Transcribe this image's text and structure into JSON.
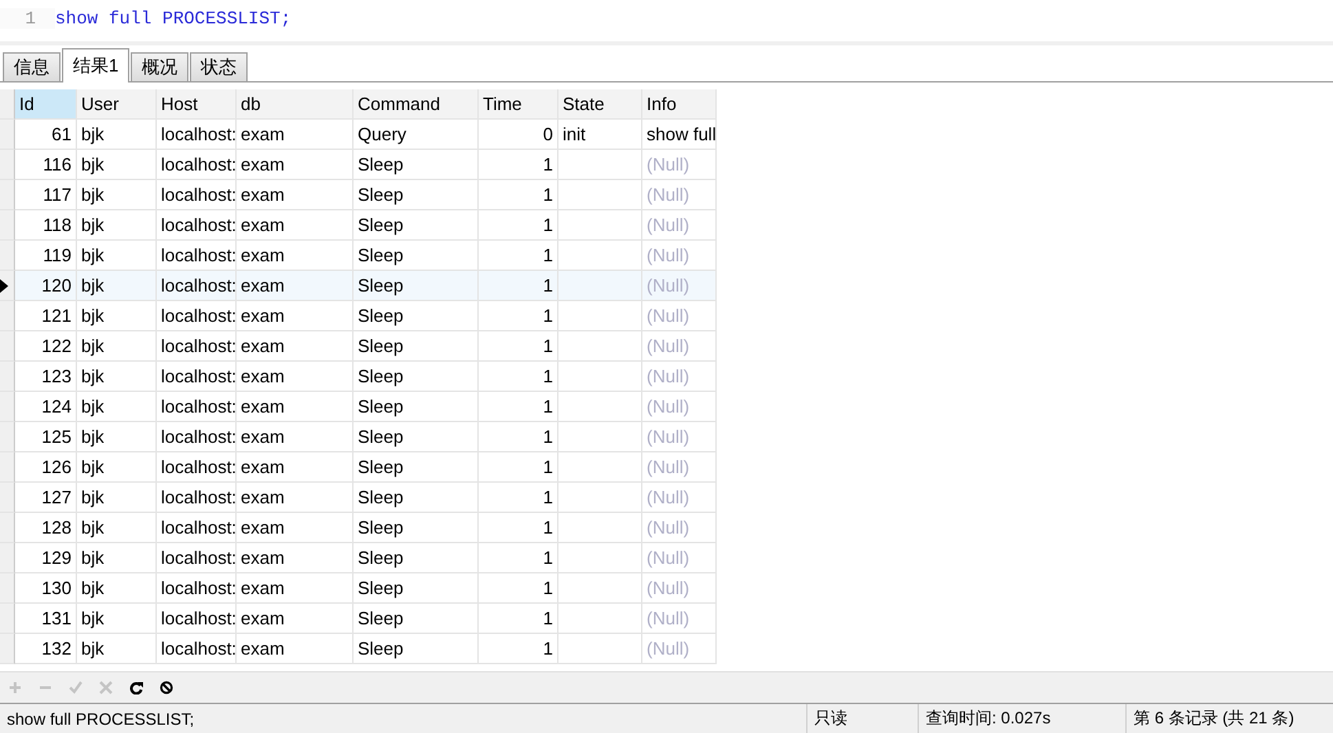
{
  "editor": {
    "lines": [
      {
        "number": "1",
        "code": "show full PROCESSLIST;"
      }
    ]
  },
  "tabs": [
    {
      "label": "信息",
      "selected": false
    },
    {
      "label": "结果1",
      "selected": true
    },
    {
      "label": "概况",
      "selected": false
    },
    {
      "label": "状态",
      "selected": false
    }
  ],
  "table": {
    "columns": [
      {
        "label": "Id",
        "selected": true
      },
      {
        "label": "User",
        "selected": false
      },
      {
        "label": "Host",
        "selected": false
      },
      {
        "label": "db",
        "selected": false
      },
      {
        "label": "Command",
        "selected": false
      },
      {
        "label": "Time",
        "selected": false
      },
      {
        "label": "State",
        "selected": false
      },
      {
        "label": "Info",
        "selected": false
      }
    ],
    "rows": [
      {
        "id": "61",
        "user": "bjk",
        "host": "localhost:",
        "db": "exam",
        "command": "Query",
        "time": "0",
        "state": "init",
        "info": "show full",
        "info_null": false,
        "selected": false
      },
      {
        "id": "116",
        "user": "bjk",
        "host": "localhost:",
        "db": "exam",
        "command": "Sleep",
        "time": "1",
        "info": "(Null)",
        "info_null": true,
        "selected": false
      },
      {
        "id": "117",
        "user": "bjk",
        "host": "localhost:",
        "db": "exam",
        "command": "Sleep",
        "time": "1",
        "info": "(Null)",
        "info_null": true,
        "selected": false
      },
      {
        "id": "118",
        "user": "bjk",
        "host": "localhost:",
        "db": "exam",
        "command": "Sleep",
        "time": "1",
        "info": "(Null)",
        "info_null": true,
        "selected": false
      },
      {
        "id": "119",
        "user": "bjk",
        "host": "localhost:",
        "db": "exam",
        "command": "Sleep",
        "time": "1",
        "info": "(Null)",
        "info_null": true,
        "selected": false
      },
      {
        "id": "120",
        "user": "bjk",
        "host": "localhost:",
        "db": "exam",
        "command": "Sleep",
        "time": "1",
        "info": "(Null)",
        "info_null": true,
        "selected": true
      },
      {
        "id": "121",
        "user": "bjk",
        "host": "localhost:",
        "db": "exam",
        "command": "Sleep",
        "time": "1",
        "info": "(Null)",
        "info_null": true,
        "selected": false
      },
      {
        "id": "122",
        "user": "bjk",
        "host": "localhost:",
        "db": "exam",
        "command": "Sleep",
        "time": "1",
        "info": "(Null)",
        "info_null": true,
        "selected": false
      },
      {
        "id": "123",
        "user": "bjk",
        "host": "localhost:",
        "db": "exam",
        "command": "Sleep",
        "time": "1",
        "info": "(Null)",
        "info_null": true,
        "selected": false
      },
      {
        "id": "124",
        "user": "bjk",
        "host": "localhost:",
        "db": "exam",
        "command": "Sleep",
        "time": "1",
        "info": "(Null)",
        "info_null": true,
        "selected": false
      },
      {
        "id": "125",
        "user": "bjk",
        "host": "localhost:",
        "db": "exam",
        "command": "Sleep",
        "time": "1",
        "info": "(Null)",
        "info_null": true,
        "selected": false
      },
      {
        "id": "126",
        "user": "bjk",
        "host": "localhost:",
        "db": "exam",
        "command": "Sleep",
        "time": "1",
        "info": "(Null)",
        "info_null": true,
        "selected": false
      },
      {
        "id": "127",
        "user": "bjk",
        "host": "localhost:",
        "db": "exam",
        "command": "Sleep",
        "time": "1",
        "info": "(Null)",
        "info_null": true,
        "selected": false
      },
      {
        "id": "128",
        "user": "bjk",
        "host": "localhost:",
        "db": "exam",
        "command": "Sleep",
        "time": "1",
        "info": "(Null)",
        "info_null": true,
        "selected": false
      },
      {
        "id": "129",
        "user": "bjk",
        "host": "localhost:",
        "db": "exam",
        "command": "Sleep",
        "time": "1",
        "info": "(Null)",
        "info_null": true,
        "selected": false
      },
      {
        "id": "130",
        "user": "bjk",
        "host": "localhost:",
        "db": "exam",
        "command": "Sleep",
        "time": "1",
        "info": "(Null)",
        "info_null": true,
        "selected": false
      },
      {
        "id": "131",
        "user": "bjk",
        "host": "localhost:",
        "db": "exam",
        "command": "Sleep",
        "time": "1",
        "info": "(Null)",
        "info_null": true,
        "selected": false
      },
      {
        "id": "132",
        "user": "bjk",
        "host": "localhost:",
        "db": "exam",
        "command": "Sleep",
        "time": "1",
        "info": "(Null)",
        "info_null": true,
        "selected": false
      }
    ]
  },
  "toolbar": [
    {
      "kind": "add",
      "disabled": true
    },
    {
      "kind": "remove",
      "disabled": true
    },
    {
      "kind": "apply",
      "disabled": true
    },
    {
      "kind": "cancel",
      "disabled": true
    },
    {
      "kind": "refresh",
      "disabled": false
    },
    {
      "kind": "stop",
      "disabled": false
    }
  ],
  "status_bar": {
    "query": "show full PROCESSLIST;",
    "mode": "只读",
    "query_time": "查询时间: 0.027s",
    "record": "第 6 条记录 (共 21 条)"
  }
}
